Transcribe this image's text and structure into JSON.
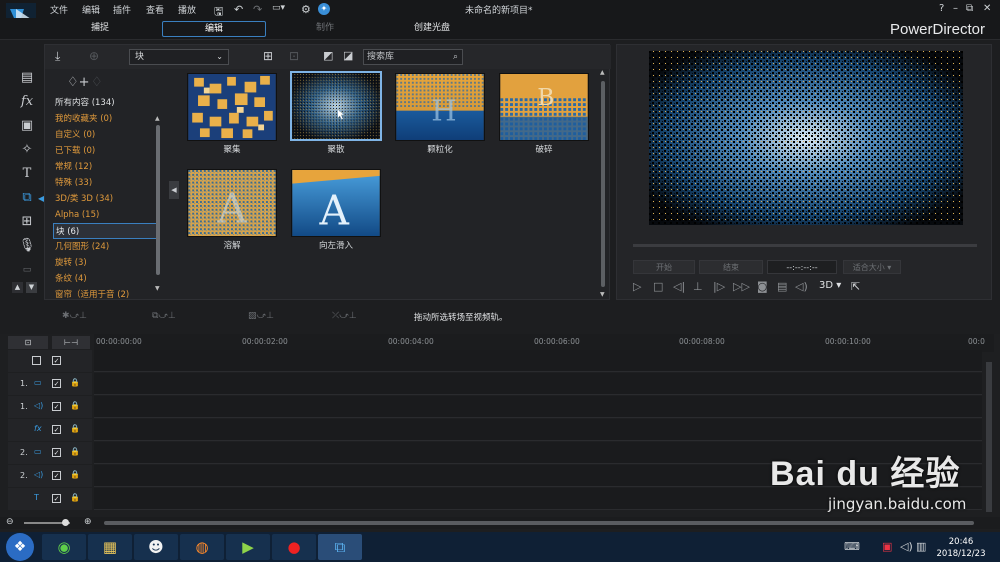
{
  "menubar": {
    "items": [
      "文件",
      "编辑",
      "插件",
      "查看",
      "播放"
    ],
    "project_title": "未命名的新项目*",
    "window_controls": [
      "?",
      "–",
      "⧉",
      "✕"
    ]
  },
  "modes": {
    "capture": "捕捉",
    "edit": "编辑",
    "produce": "制作",
    "disc": "创建光盘"
  },
  "brand": "PowerDirector",
  "library": {
    "dropdown_value": "块",
    "search_placeholder": "搜索库",
    "categories": [
      "所有内容 (134)",
      "我的收藏夹 (0)",
      "自定义 (0)",
      "已下载 (0)",
      "常规 (12)",
      "特殊 (33)",
      "3D/类 3D (34)",
      "Alpha (15)",
      "块 (6)",
      "几何图形 (24)",
      "旋转 (3)",
      "条纹 (4)",
      "窗帘（适用于音 (2)"
    ],
    "items": [
      "聚集",
      "聚散",
      "颗粒化",
      "破碎",
      "溶解",
      "向左滑入"
    ]
  },
  "preview": {
    "btn_start": "开始",
    "btn_end": "结束",
    "timecode": "--:--:--:--",
    "fit_label": "适合大小",
    "mode3d": "3D"
  },
  "hint": "拖动所选转场至视频轨。",
  "ruler": [
    "00:00:00:00",
    "00:00:02:00",
    "00:00:04:00",
    "00:00:06:00",
    "00:00:08:00",
    "00:00:10:00",
    "00:0"
  ],
  "tracks": [
    {
      "num": "",
      "icon": ""
    },
    {
      "num": "1.",
      "icon": "▭"
    },
    {
      "num": "1.",
      "icon": "◁)"
    },
    {
      "num": "",
      "icon": "fx"
    },
    {
      "num": "2.",
      "icon": "▭"
    },
    {
      "num": "2.",
      "icon": "◁)"
    },
    {
      "num": "",
      "icon": "T"
    }
  ],
  "clock": {
    "time": "20:46",
    "date": "2018/12/23"
  },
  "watermark": {
    "brand": "Bai du 经验",
    "url": "jingyan.baidu.com"
  }
}
